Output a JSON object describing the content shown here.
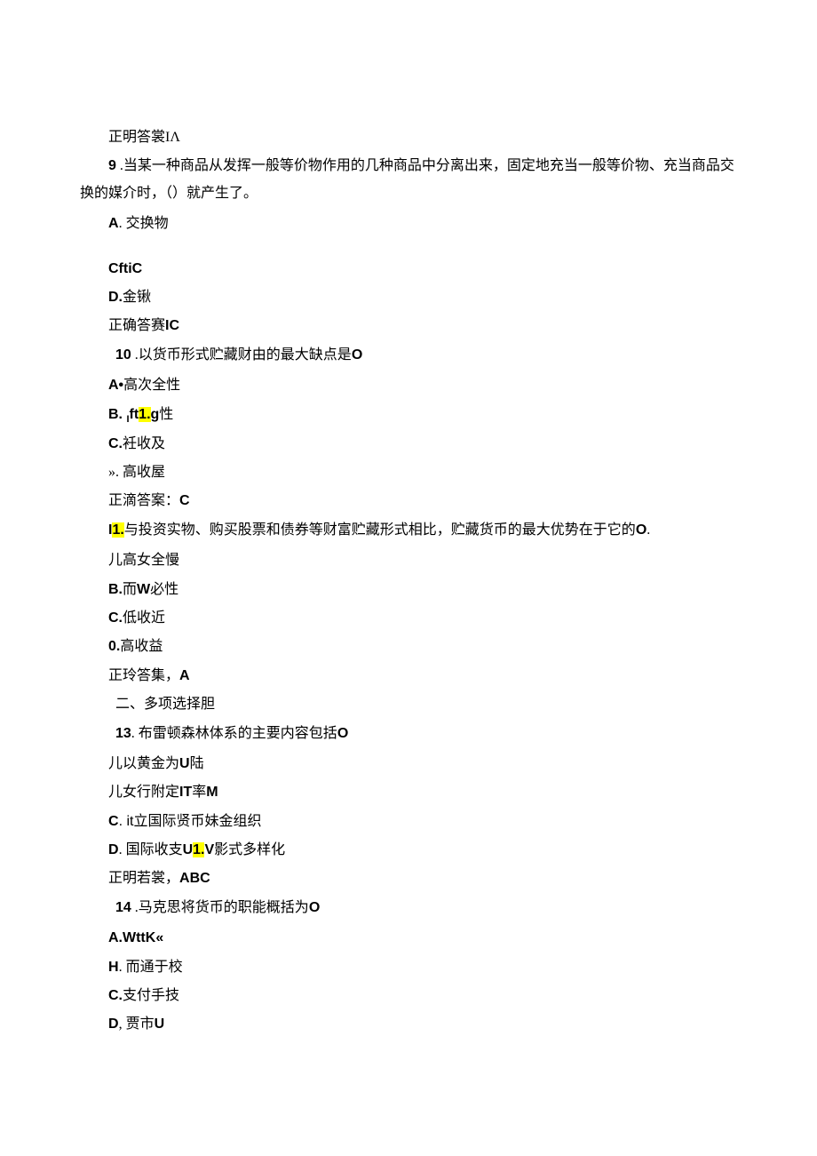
{
  "lines": {
    "a0": "正明答裳IΛ",
    "q9_num": "9",
    "q9_text": " .当某一种商品从发挥一般等价物作用的几种商品中分离出来，固定地充当一般等价物、充当商品交换的媒介时，（）就产生了。",
    "q9_a": "A",
    "q9_a_text": ". 交换物",
    "q9_c": "CftiC",
    "q9_d_pre": "D.",
    "q9_d_text": "金锹",
    "q9_ans_pre": "正确答赛",
    "q9_ans_val": "IC",
    "q10_num": "10",
    "q10_text": "     .以货币形式贮藏财由的最大缺点是",
    "q10_o": "O",
    "q10_a": "A•",
    "q10_a_text": "高次全性",
    "q10_b": "B.  ",
    "q10_b_sub": "I",
    "q10_b_mid": "ft",
    "q10_b_hl": "1.",
    "q10_b_end": "g",
    "q10_b_tail": "性",
    "q10_c": "C.",
    "q10_c_text": "衽收及",
    "q10_d": "». 高收屋",
    "q10_ans": "正滴答案：",
    "q10_ans_val": "C",
    "q11_pre": "I",
    "q11_hl": "1.",
    "q11_text": "与投资实物、购买股票和债券等财富贮藏形式相比，贮藏货币的最大优势在于它的",
    "q11_o": "O",
    "q11_dot": ".",
    "q11_a": "儿高女全慢",
    "q11_b": "B.",
    "q11_b_text": "而",
    "q11_b_w": "W",
    "q11_b_tail": "必性",
    "q11_c": "C.",
    "q11_c_text": "低收近",
    "q11_d": "0.",
    "q11_d_text": "高收益",
    "q11_ans": "正玲答集，",
    "q11_ans_val": "A",
    "sec2": "二、多项选择胆",
    "q13_num": "13",
    "q13_text": ". 布雷顿森林体系的主要内容包括",
    "q13_o": "O",
    "q13_a": "儿以黄金为",
    "q13_a_u": "U",
    "q13_a_tail": "陆",
    "q13_b": "儿女行附定",
    "q13_b_it": "IT",
    "q13_b_mid": "率",
    "q13_b_m": "M",
    "q13_c": "C",
    "q13_c_text": ".  it",
    "q13_c_tail": "立国际贤币妹金组织",
    "q13_d": "D",
    "q13_d_text": ". 国际收支",
    "q13_d_u": "U",
    "q13_d_hl": "1.",
    "q13_d_v": "V",
    "q13_d_tail": "影式多样化",
    "q13_ans": "正明若裳，",
    "q13_ans_val": "ABC",
    "q14_num": "14",
    "q14_text": " .马克思将货币的职能概括为",
    "q14_o": "O",
    "q14_a": "A.WttK«",
    "q14_b": "H",
    "q14_b_text": ". 而通于校",
    "q14_c": "C.",
    "q14_c_text": "支付手技",
    "q14_d": "D",
    "q14_d_text": ", 贾市",
    "q14_d_u": "U"
  }
}
